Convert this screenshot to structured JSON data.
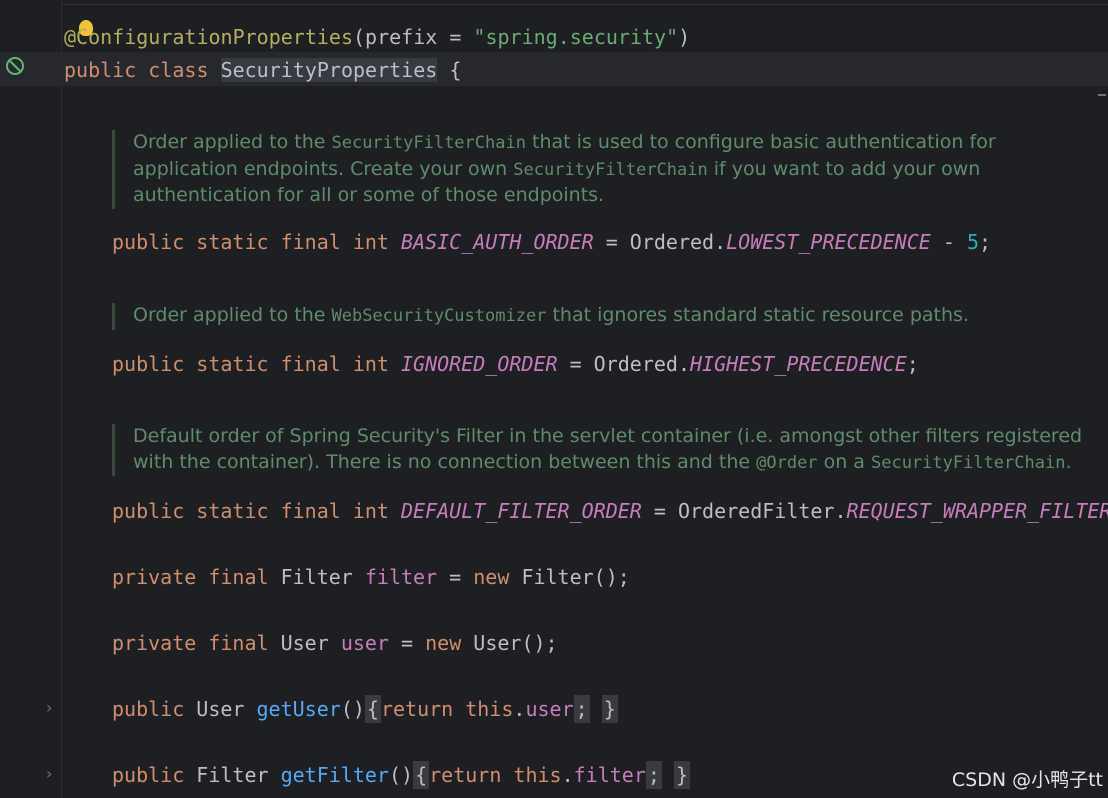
{
  "annotation": {
    "at": "@",
    "name": "ConfigurationProperties",
    "param": "prefix",
    "eq": " = ",
    "value": "\"spring.security\""
  },
  "class_decl": {
    "kw_public": "public",
    "kw_class": "class",
    "name": "SecurityProperties",
    "brace": "{"
  },
  "doc1": {
    "p1": "Order applied to the ",
    "c1": "SecurityFilterChain",
    "p2": " that is used to configure basic authentication for application endpoints. Create your own ",
    "c2": "SecurityFilterChain",
    "p3": " if you want to add your own authentication for all or some of those endpoints."
  },
  "field1": {
    "mods": "public static final int",
    "name": "BASIC_AUTH_ORDER",
    "eq": " = ",
    "cls": "Ordered.",
    "const": "LOWEST_PRECEDENCE",
    "op": " - ",
    "num": "5",
    "end": ";"
  },
  "doc2": {
    "p1": "Order applied to the ",
    "c1": "WebSecurityCustomizer",
    "p2": " that ignores standard static resource paths."
  },
  "field2": {
    "mods": "public static final int",
    "name": "IGNORED_ORDER",
    "eq": " = ",
    "cls": "Ordered.",
    "const": "HIGHEST_PRECEDENCE",
    "end": ";"
  },
  "doc3": {
    "p1": "Default order of Spring Security's Filter in the servlet container (i.e. amongst other filters registered with the container). There is no connection between this and the ",
    "c1": "@Order",
    "p2": " on a ",
    "c2": "SecurityFilterChain",
    "p3": "."
  },
  "field3": {
    "mods": "public static final int",
    "name": "DEFAULT_FILTER_ORDER",
    "eq": " = ",
    "cls": "OrderedFilter.",
    "const": "REQUEST_WRAPPER_FILTER"
  },
  "field4": {
    "mods": "private final",
    "type": "Filter",
    "name": "filter",
    "eq": " = ",
    "kw_new": "new",
    "ctor": "Filter();"
  },
  "field5": {
    "mods": "private final",
    "type": "User",
    "name": "user",
    "eq": " = ",
    "kw_new": "new",
    "ctor": "User();"
  },
  "method1": {
    "kw": "public",
    "type": "User",
    "name": "getUser",
    "parens": "()",
    "open": "{",
    "ret": "return",
    "this": "this",
    "dot": ".",
    "field": "user",
    "semi": ";",
    "close": "}"
  },
  "method2": {
    "kw": "public",
    "type": "Filter",
    "name": "getFilter",
    "parens": "()",
    "open": "{",
    "ret": "return",
    "this": "this",
    "dot": ".",
    "field": "filter",
    "semi": ";",
    "close": "}"
  },
  "icons": {
    "bulb": "lightbulb-icon",
    "spring_bean": "spring-bean-gutter-icon",
    "fold": "chevron-right-icon"
  },
  "fold_glyph": "›",
  "watermark": "CSDN @小鸭子tt"
}
